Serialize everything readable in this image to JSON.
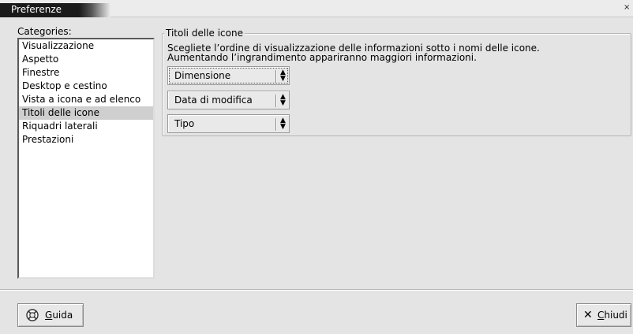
{
  "window": {
    "title": "Preferenze"
  },
  "sidebar": {
    "label": "Categories:",
    "items": [
      {
        "label": "Visualizzazione",
        "selected": false
      },
      {
        "label": "Aspetto",
        "selected": false
      },
      {
        "label": "Finestre",
        "selected": false
      },
      {
        "label": "Desktop e cestino",
        "selected": false
      },
      {
        "label": "Vista a icona e ad elenco",
        "selected": false
      },
      {
        "label": "Titoli delle icone",
        "selected": true
      },
      {
        "label": "Riquadri laterali",
        "selected": false
      },
      {
        "label": "Prestazioni",
        "selected": false
      }
    ]
  },
  "panel": {
    "title": "Titoli delle icone",
    "description_line1": "Scegliete l’ordine di visualizzazione delle informazioni sotto i nomi delle icone.",
    "description_line2": "Aumentando l’ingrandimento appariranno maggiori informazioni.",
    "combos": [
      {
        "value": "Dimensione",
        "focused": true
      },
      {
        "value": "Data di modifica",
        "focused": false
      },
      {
        "value": "Tipo",
        "focused": false
      }
    ]
  },
  "footer": {
    "help_label": "Guida",
    "close_label": "Chiudi"
  },
  "icons": {
    "help": "lifebuoy-icon",
    "close": "close-x-icon",
    "combo_arrow": "up-down-arrow-icon"
  }
}
